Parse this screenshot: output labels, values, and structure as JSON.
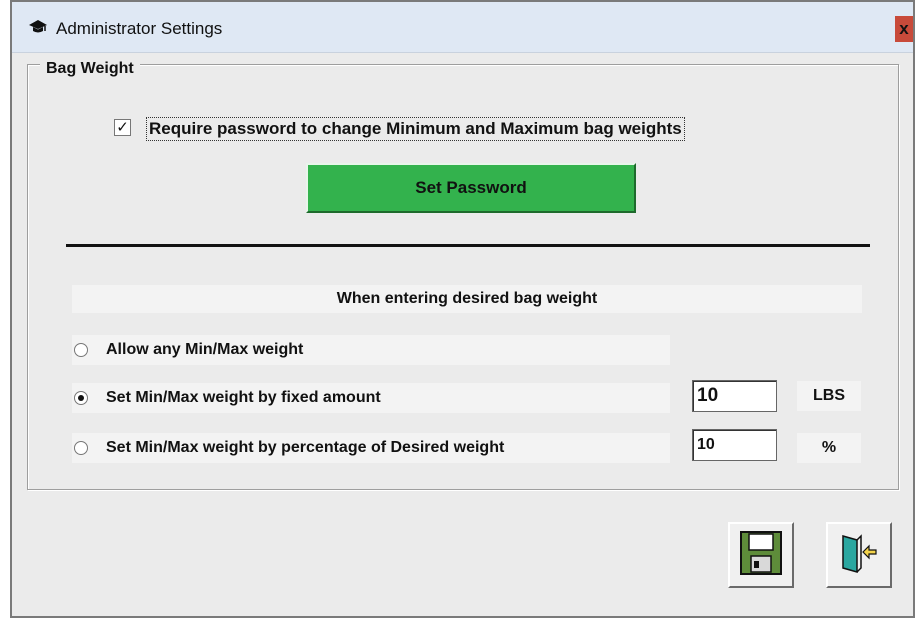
{
  "window": {
    "title": "Administrator Settings",
    "title_icon": "graduation-cap-icon",
    "close_label": "x"
  },
  "bag_weight": {
    "group_label": "Bag Weight",
    "require_password": {
      "label": "Require password to change Minimum and Maximum bag weights",
      "checked": true
    },
    "set_password_label": "Set Password",
    "set_password_color": "#33b24d",
    "section_header": "When entering desired bag weight",
    "options": [
      {
        "label": "Allow any Min/Max weight",
        "selected": false
      },
      {
        "label": "Set Min/Max weight by fixed amount",
        "selected": true
      },
      {
        "label": "Set Min/Max weight by percentage of Desired weight",
        "selected": false
      }
    ],
    "fixed_amount": {
      "value": "10",
      "unit": "LBS"
    },
    "percentage": {
      "value": "10",
      "unit": "%"
    }
  },
  "actions": {
    "save_icon": "floppy-disk-icon",
    "exit_icon": "exit-door-icon"
  }
}
